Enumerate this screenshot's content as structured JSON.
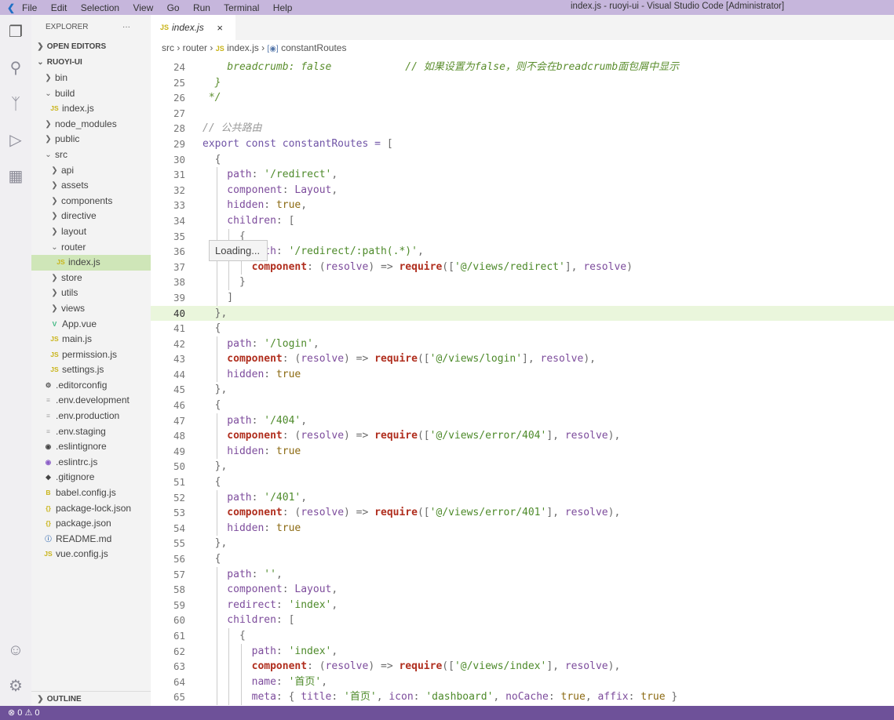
{
  "titlebar": {
    "menu": [
      "File",
      "Edit",
      "Selection",
      "View",
      "Go",
      "Run",
      "Terminal",
      "Help"
    ],
    "title": "index.js - ruoyi-ui - Visual Studio Code [Administrator]"
  },
  "sidebar": {
    "header": "EXPLORER",
    "more": "···",
    "open_editors": "OPEN EDITORS",
    "root": "RUOYI-UI",
    "outline": "OUTLINE",
    "items": [
      {
        "label": "bin",
        "depth": 1,
        "kind": "folder-closed"
      },
      {
        "label": "build",
        "depth": 1,
        "kind": "folder-open"
      },
      {
        "label": "index.js",
        "depth": 2,
        "kind": "js"
      },
      {
        "label": "node_modules",
        "depth": 1,
        "kind": "folder-closed"
      },
      {
        "label": "public",
        "depth": 1,
        "kind": "folder-closed"
      },
      {
        "label": "src",
        "depth": 1,
        "kind": "folder-open"
      },
      {
        "label": "api",
        "depth": 2,
        "kind": "folder-closed"
      },
      {
        "label": "assets",
        "depth": 2,
        "kind": "folder-closed"
      },
      {
        "label": "components",
        "depth": 2,
        "kind": "folder-closed"
      },
      {
        "label": "directive",
        "depth": 2,
        "kind": "folder-closed"
      },
      {
        "label": "layout",
        "depth": 2,
        "kind": "folder-closed"
      },
      {
        "label": "router",
        "depth": 2,
        "kind": "folder-open"
      },
      {
        "label": "index.js",
        "depth": 3,
        "kind": "js",
        "selected": true
      },
      {
        "label": "store",
        "depth": 2,
        "kind": "folder-closed"
      },
      {
        "label": "utils",
        "depth": 2,
        "kind": "folder-closed"
      },
      {
        "label": "views",
        "depth": 2,
        "kind": "folder-closed"
      },
      {
        "label": "App.vue",
        "depth": 2,
        "kind": "vue"
      },
      {
        "label": "main.js",
        "depth": 2,
        "kind": "js"
      },
      {
        "label": "permission.js",
        "depth": 2,
        "kind": "js"
      },
      {
        "label": "settings.js",
        "depth": 2,
        "kind": "js"
      },
      {
        "label": ".editorconfig",
        "depth": 1,
        "kind": "gear"
      },
      {
        "label": ".env.development",
        "depth": 1,
        "kind": "text"
      },
      {
        "label": ".env.production",
        "depth": 1,
        "kind": "text"
      },
      {
        "label": ".env.staging",
        "depth": 1,
        "kind": "text"
      },
      {
        "label": ".eslintignore",
        "depth": 1,
        "kind": "eslint-dark"
      },
      {
        "label": ".eslintrc.js",
        "depth": 1,
        "kind": "eslint"
      },
      {
        "label": ".gitignore",
        "depth": 1,
        "kind": "git"
      },
      {
        "label": "babel.config.js",
        "depth": 1,
        "kind": "babel"
      },
      {
        "label": "package-lock.json",
        "depth": 1,
        "kind": "json"
      },
      {
        "label": "package.json",
        "depth": 1,
        "kind": "json"
      },
      {
        "label": "README.md",
        "depth": 1,
        "kind": "info"
      },
      {
        "label": "vue.config.js",
        "depth": 1,
        "kind": "js"
      }
    ]
  },
  "tab": {
    "badge": "JS",
    "label": "index.js",
    "close": "×"
  },
  "breadcrumb": {
    "parts": [
      "src",
      "router"
    ],
    "file": "index.js",
    "symbol": "constantRoutes"
  },
  "tooltip": "Loading...",
  "status": {
    "errors": "0",
    "warnings": "0"
  },
  "colors": {
    "titlebar": "#c6b6dc",
    "statusbar": "#6e5199",
    "selection": "#cfe6b8"
  },
  "code": {
    "current_line": 40,
    "lines": [
      {
        "n": 24,
        "t": [
          [
            "c",
            "    breadcrumb: false            // 如果设置为false，则不会在breadcrumb面包屑中显示"
          ]
        ]
      },
      {
        "n": 25,
        "t": [
          [
            "c",
            "  }"
          ]
        ]
      },
      {
        "n": 26,
        "t": [
          [
            "c",
            " */"
          ]
        ]
      },
      {
        "n": 27,
        "t": []
      },
      {
        "n": 28,
        "t": [
          [
            "g",
            "// 公共路由"
          ]
        ]
      },
      {
        "n": 29,
        "t": [
          [
            "k",
            "export const constantRoutes = "
          ],
          [
            "o",
            "["
          ]
        ]
      },
      {
        "n": 30,
        "t": [
          [
            "o",
            "  {"
          ]
        ]
      },
      {
        "n": 31,
        "t": [
          [
            "p",
            "    path"
          ],
          [
            "o",
            ": "
          ],
          [
            "s",
            "'/redirect'"
          ],
          [
            "o",
            ","
          ]
        ]
      },
      {
        "n": 32,
        "t": [
          [
            "p",
            "    component"
          ],
          [
            "o",
            ": "
          ],
          [
            "p",
            "Layout"
          ],
          [
            "o",
            ","
          ]
        ]
      },
      {
        "n": 33,
        "t": [
          [
            "p",
            "    hidden"
          ],
          [
            "o",
            ": "
          ],
          [
            "t",
            "true"
          ],
          [
            "o",
            ","
          ]
        ]
      },
      {
        "n": 34,
        "t": [
          [
            "p",
            "    children"
          ],
          [
            "o",
            ": ["
          ]
        ]
      },
      {
        "n": 35,
        "t": [
          [
            "o",
            "      {"
          ]
        ]
      },
      {
        "n": 36,
        "t": [
          [
            "p",
            "        path"
          ],
          [
            "o",
            ": "
          ],
          [
            "s",
            "'/redirect/:path(.*)'"
          ],
          [
            "o",
            ","
          ]
        ]
      },
      {
        "n": 37,
        "t": [
          [
            "b",
            "        component"
          ],
          [
            "o",
            ": ("
          ],
          [
            "p",
            "resolve"
          ],
          [
            "o",
            ") => "
          ],
          [
            "b",
            "require"
          ],
          [
            "o",
            "(["
          ],
          [
            "s",
            "'@/views/redirect'"
          ],
          [
            "o",
            "], "
          ],
          [
            "p",
            "resolve"
          ],
          [
            "o",
            ")"
          ]
        ]
      },
      {
        "n": 38,
        "t": [
          [
            "o",
            "      }"
          ]
        ]
      },
      {
        "n": 39,
        "t": [
          [
            "o",
            "    ]"
          ]
        ]
      },
      {
        "n": 40,
        "t": [
          [
            "o",
            "  },"
          ]
        ]
      },
      {
        "n": 41,
        "t": [
          [
            "o",
            "  {"
          ]
        ]
      },
      {
        "n": 42,
        "t": [
          [
            "p",
            "    path"
          ],
          [
            "o",
            ": "
          ],
          [
            "s",
            "'/login'"
          ],
          [
            "o",
            ","
          ]
        ]
      },
      {
        "n": 43,
        "t": [
          [
            "b",
            "    component"
          ],
          [
            "o",
            ": ("
          ],
          [
            "p",
            "resolve"
          ],
          [
            "o",
            ") => "
          ],
          [
            "b",
            "require"
          ],
          [
            "o",
            "(["
          ],
          [
            "s",
            "'@/views/login'"
          ],
          [
            "o",
            "], "
          ],
          [
            "p",
            "resolve"
          ],
          [
            "o",
            "),"
          ]
        ]
      },
      {
        "n": 44,
        "t": [
          [
            "p",
            "    hidden"
          ],
          [
            "o",
            ": "
          ],
          [
            "t",
            "true"
          ]
        ]
      },
      {
        "n": 45,
        "t": [
          [
            "o",
            "  },"
          ]
        ]
      },
      {
        "n": 46,
        "t": [
          [
            "o",
            "  {"
          ]
        ]
      },
      {
        "n": 47,
        "t": [
          [
            "p",
            "    path"
          ],
          [
            "o",
            ": "
          ],
          [
            "s",
            "'/404'"
          ],
          [
            "o",
            ","
          ]
        ]
      },
      {
        "n": 48,
        "t": [
          [
            "b",
            "    component"
          ],
          [
            "o",
            ": ("
          ],
          [
            "p",
            "resolve"
          ],
          [
            "o",
            ") => "
          ],
          [
            "b",
            "require"
          ],
          [
            "o",
            "(["
          ],
          [
            "s",
            "'@/views/error/404'"
          ],
          [
            "o",
            "], "
          ],
          [
            "p",
            "resolve"
          ],
          [
            "o",
            "),"
          ]
        ]
      },
      {
        "n": 49,
        "t": [
          [
            "p",
            "    hidden"
          ],
          [
            "o",
            ": "
          ],
          [
            "t",
            "true"
          ]
        ]
      },
      {
        "n": 50,
        "t": [
          [
            "o",
            "  },"
          ]
        ]
      },
      {
        "n": 51,
        "t": [
          [
            "o",
            "  {"
          ]
        ]
      },
      {
        "n": 52,
        "t": [
          [
            "p",
            "    path"
          ],
          [
            "o",
            ": "
          ],
          [
            "s",
            "'/401'"
          ],
          [
            "o",
            ","
          ]
        ]
      },
      {
        "n": 53,
        "t": [
          [
            "b",
            "    component"
          ],
          [
            "o",
            ": ("
          ],
          [
            "p",
            "resolve"
          ],
          [
            "o",
            ") => "
          ],
          [
            "b",
            "require"
          ],
          [
            "o",
            "(["
          ],
          [
            "s",
            "'@/views/error/401'"
          ],
          [
            "o",
            "], "
          ],
          [
            "p",
            "resolve"
          ],
          [
            "o",
            "),"
          ]
        ]
      },
      {
        "n": 54,
        "t": [
          [
            "p",
            "    hidden"
          ],
          [
            "o",
            ": "
          ],
          [
            "t",
            "true"
          ]
        ]
      },
      {
        "n": 55,
        "t": [
          [
            "o",
            "  },"
          ]
        ]
      },
      {
        "n": 56,
        "t": [
          [
            "o",
            "  {"
          ]
        ]
      },
      {
        "n": 57,
        "t": [
          [
            "p",
            "    path"
          ],
          [
            "o",
            ": "
          ],
          [
            "s",
            "''"
          ],
          [
            "o",
            ","
          ]
        ]
      },
      {
        "n": 58,
        "t": [
          [
            "p",
            "    component"
          ],
          [
            "o",
            ": "
          ],
          [
            "p",
            "Layout"
          ],
          [
            "o",
            ","
          ]
        ]
      },
      {
        "n": 59,
        "t": [
          [
            "p",
            "    redirect"
          ],
          [
            "o",
            ": "
          ],
          [
            "s",
            "'index'"
          ],
          [
            "o",
            ","
          ]
        ]
      },
      {
        "n": 60,
        "t": [
          [
            "p",
            "    children"
          ],
          [
            "o",
            ": ["
          ]
        ]
      },
      {
        "n": 61,
        "t": [
          [
            "o",
            "      {"
          ]
        ]
      },
      {
        "n": 62,
        "t": [
          [
            "p",
            "        path"
          ],
          [
            "o",
            ": "
          ],
          [
            "s",
            "'index'"
          ],
          [
            "o",
            ","
          ]
        ]
      },
      {
        "n": 63,
        "t": [
          [
            "b",
            "        component"
          ],
          [
            "o",
            ": ("
          ],
          [
            "p",
            "resolve"
          ],
          [
            "o",
            ") => "
          ],
          [
            "b",
            "require"
          ],
          [
            "o",
            "(["
          ],
          [
            "s",
            "'@/views/index'"
          ],
          [
            "o",
            "], "
          ],
          [
            "p",
            "resolve"
          ],
          [
            "o",
            "),"
          ]
        ]
      },
      {
        "n": 64,
        "t": [
          [
            "p",
            "        name"
          ],
          [
            "o",
            ": "
          ],
          [
            "s",
            "'首页'"
          ],
          [
            "o",
            ","
          ]
        ]
      },
      {
        "n": 65,
        "t": [
          [
            "p",
            "        meta"
          ],
          [
            "o",
            ": { "
          ],
          [
            "p",
            "title"
          ],
          [
            "o",
            ": "
          ],
          [
            "s",
            "'首页'"
          ],
          [
            "o",
            ", "
          ],
          [
            "p",
            "icon"
          ],
          [
            "o",
            ": "
          ],
          [
            "s",
            "'dashboard'"
          ],
          [
            "o",
            ", "
          ],
          [
            "p",
            "noCache"
          ],
          [
            "o",
            ": "
          ],
          [
            "t",
            "true"
          ],
          [
            "o",
            ", "
          ],
          [
            "p",
            "affix"
          ],
          [
            "o",
            ": "
          ],
          [
            "t",
            "true"
          ],
          [
            "o",
            " }"
          ]
        ]
      }
    ]
  }
}
